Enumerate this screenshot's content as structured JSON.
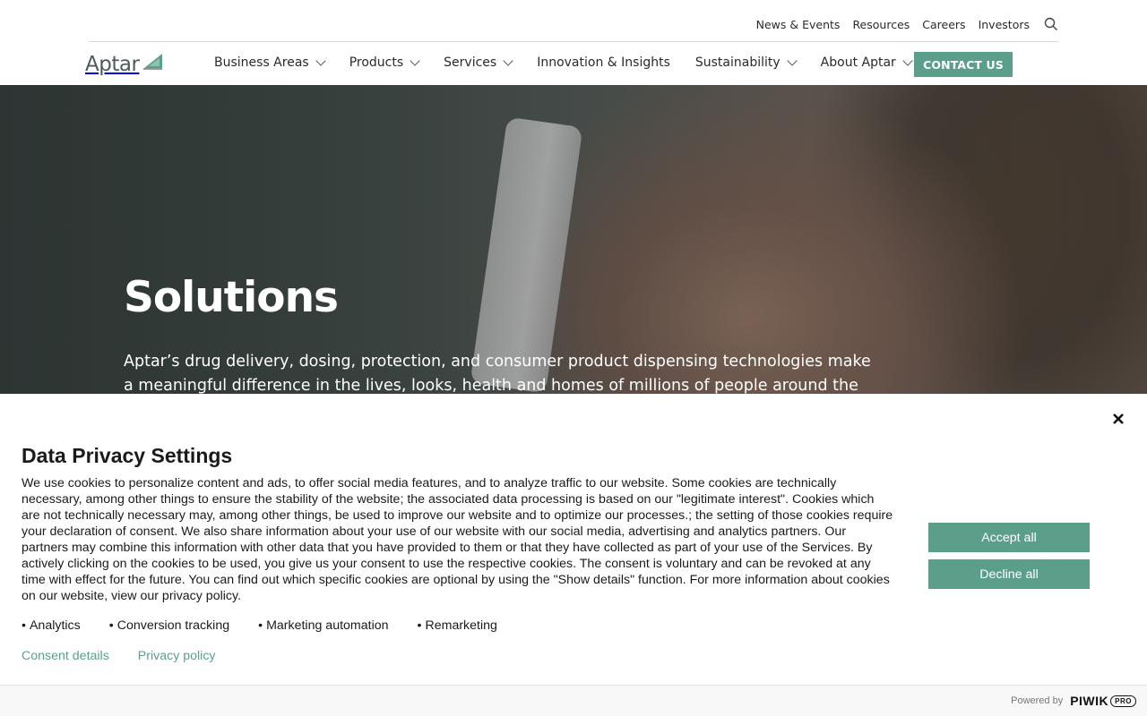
{
  "utility_nav": {
    "items": [
      "News & Events",
      "Resources",
      "Careers",
      "Investors"
    ],
    "search_icon": "search-icon"
  },
  "logo": {
    "text": "Aptar",
    "mark_icon": "sail-logo-icon",
    "mark_color": "#5b9f8a"
  },
  "main_nav": {
    "items": [
      {
        "label": "Business Areas",
        "has_dropdown": true
      },
      {
        "label": "Products",
        "has_dropdown": true
      },
      {
        "label": "Services",
        "has_dropdown": true
      },
      {
        "label": "Innovation & Insights",
        "has_dropdown": false
      },
      {
        "label": "Sustainability",
        "has_dropdown": true
      },
      {
        "label": "About Aptar",
        "has_dropdown": true
      }
    ],
    "contact_label": "CONTACT US"
  },
  "hero": {
    "title": "Solutions",
    "text": "Aptar’s drug delivery, dosing, protection, and consumer product dispensing technologies make a meaningful difference in the lives, looks, health and homes of millions of people around the world."
  },
  "consent": {
    "title": "Data Privacy Settings",
    "body": "We use cookies to personalize content and ads, to offer social media features, and to analyze traffic to our website. Some cookies are technically necessary, among other things to ensure the stability of the website; the associated data processing is based on our \"legitimate interest\". Cookies which are not technically necessary may, among other things, be used to improve our website and to optimize our processes.; the setting of those cookies require your declaration of consent. We also share information about your use of our website with our social media, advertising and analytics partners. Our partners may combine this information with other data that you have provided to them or that they have collected as part of your use of the Services. By actively clicking on the cookies to be used, you give us your consent to use the respective cookies. The consent is voluntary and can be revoked at any time with effect for the future. You can find out which specific cookies are optional by using the \"Show details\" function. For more information about cookies on our website, view our privacy policy.",
    "categories": [
      "Analytics",
      "Conversion tracking",
      "Marketing automation",
      "Remarketing"
    ],
    "links": {
      "details": "Consent details",
      "privacy": "Privacy policy"
    },
    "accept_label": "Accept all",
    "decline_label": "Decline all",
    "close_icon": "close-icon",
    "powered_by": "Powered by",
    "powered_brand": "PIWIK",
    "powered_brand_suffix": "PRO"
  },
  "colors": {
    "accent": "#5b9f8a"
  }
}
